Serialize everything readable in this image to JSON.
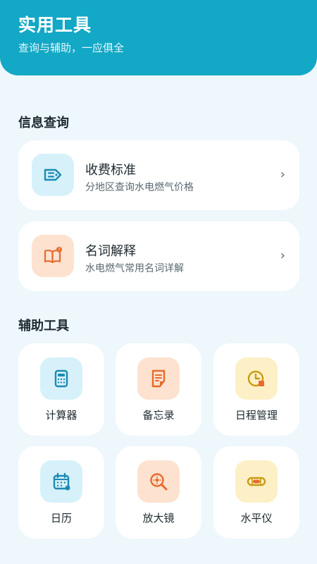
{
  "header": {
    "title": "实用工具",
    "subtitle": "查询与辅助，一应俱全"
  },
  "info_section": {
    "title": "信息查询",
    "cards": [
      {
        "title": "收费标准",
        "subtitle": "分地区查询水电燃气价格",
        "icon": "price-tag-icon",
        "chevron": "›"
      },
      {
        "title": "名词解释",
        "subtitle": "水电燃气常用名词详解",
        "icon": "book-icon",
        "chevron": "›"
      }
    ]
  },
  "tools_section": {
    "title": "辅助工具",
    "tiles": [
      {
        "label": "计算器",
        "icon": "calculator-icon"
      },
      {
        "label": "备忘录",
        "icon": "memo-icon"
      },
      {
        "label": "日程管理",
        "icon": "clock-icon"
      },
      {
        "label": "日历",
        "icon": "calendar-icon"
      },
      {
        "label": "放大镜",
        "icon": "magnifier-icon"
      },
      {
        "label": "水平仪",
        "icon": "level-icon"
      }
    ]
  },
  "colors": {
    "header": "#12a8c6",
    "icon_blue": "#1b8ab2",
    "icon_orange": "#e86a2c",
    "icon_yellow": "#c99a14"
  }
}
